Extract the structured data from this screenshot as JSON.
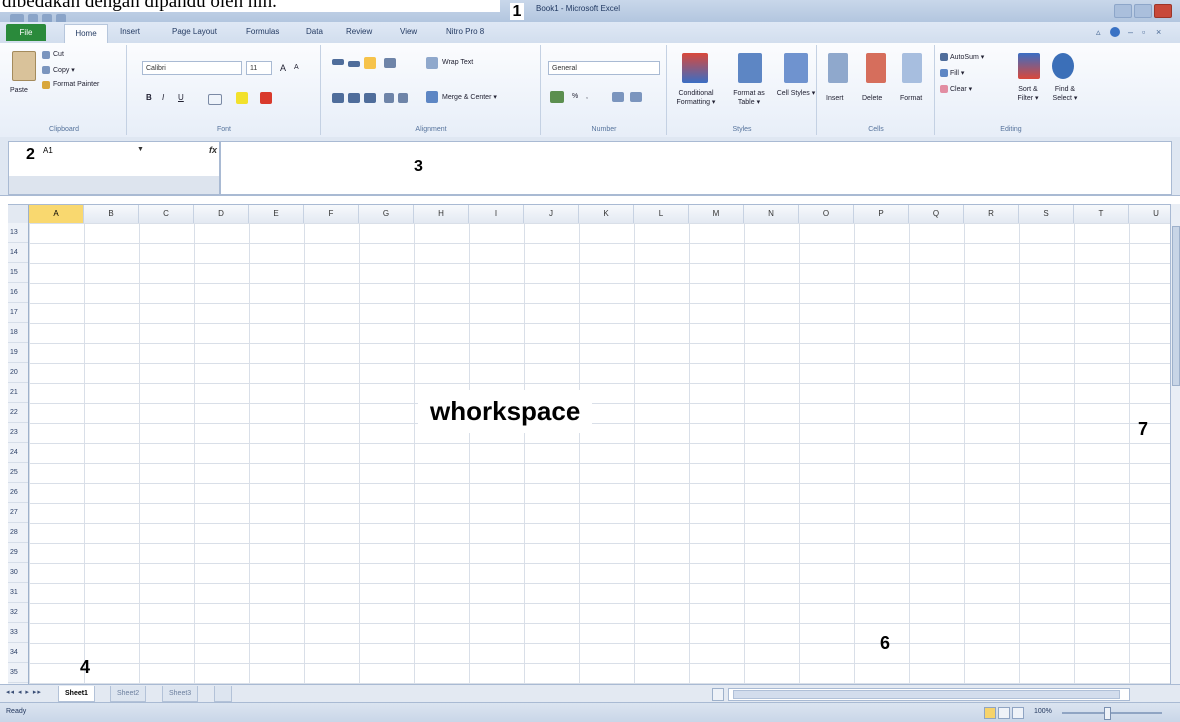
{
  "caption": "dibedakan dengan dipandu oleh nih.",
  "window": {
    "title": "Book1 - Microsoft Excel"
  },
  "tabs": {
    "file": "File",
    "items": [
      "Home",
      "Insert",
      "Page Layout",
      "Formulas",
      "Data",
      "Review",
      "View",
      "Nitro Pro 8"
    ]
  },
  "ribbon": {
    "clipboard": {
      "label": "Clipboard",
      "paste": "Paste",
      "cut": "Cut",
      "copy": "Copy ▾",
      "format_painter": "Format Painter"
    },
    "font": {
      "label": "Font",
      "name": "Calibri",
      "size": "11",
      "grow": "A",
      "shrink": "A",
      "bold": "B",
      "italic": "I",
      "underline": "U"
    },
    "alignment": {
      "label": "Alignment",
      "wrap": "Wrap Text",
      "merge": "Merge & Center ▾"
    },
    "number": {
      "label": "Number",
      "format": "General",
      "percent": "%",
      "comma": ","
    },
    "styles": {
      "label": "Styles",
      "conditional": "Conditional Formatting ▾",
      "format_table": "Format as Table ▾",
      "cell_styles": "Cell Styles ▾"
    },
    "cells": {
      "label": "Cells",
      "insert": "Insert",
      "delete": "Delete",
      "format": "Format"
    },
    "editing": {
      "label": "Editing",
      "autosum": "AutoSum ▾",
      "fill": "Fill ▾",
      "clear": "Clear ▾",
      "sort": "Sort & Filter ▾",
      "find": "Find & Select ▾"
    }
  },
  "formula_bar": {
    "name_box": "A1",
    "fx": "fx",
    "value": ""
  },
  "markers": {
    "m1": "1",
    "m2": "2",
    "m3": "3",
    "m4": "4",
    "m6": "6",
    "m7": "7"
  },
  "columns": [
    "A",
    "B",
    "C",
    "D",
    "E",
    "F",
    "G",
    "H",
    "I",
    "J",
    "K",
    "L",
    "M",
    "N",
    "O",
    "P",
    "Q",
    "R",
    "S",
    "T",
    "U"
  ],
  "selected_column": "A",
  "rows": [
    "13",
    "14",
    "15",
    "16",
    "17",
    "18",
    "19",
    "20",
    "21",
    "22",
    "23",
    "24",
    "25",
    "26",
    "27",
    "28",
    "29",
    "30",
    "31",
    "32",
    "33",
    "34",
    "35"
  ],
  "workspace_label": "whorkspace",
  "sheets": [
    "Sheet1",
    "Sheet2",
    "Sheet3"
  ],
  "active_sheet": "Sheet1",
  "status": {
    "text": "Ready",
    "zoom": "100%"
  },
  "colors": {
    "accent": "#2a8a3b",
    "selected_header": "#f9d86f",
    "ribbon_bg": "#e7eef8"
  }
}
